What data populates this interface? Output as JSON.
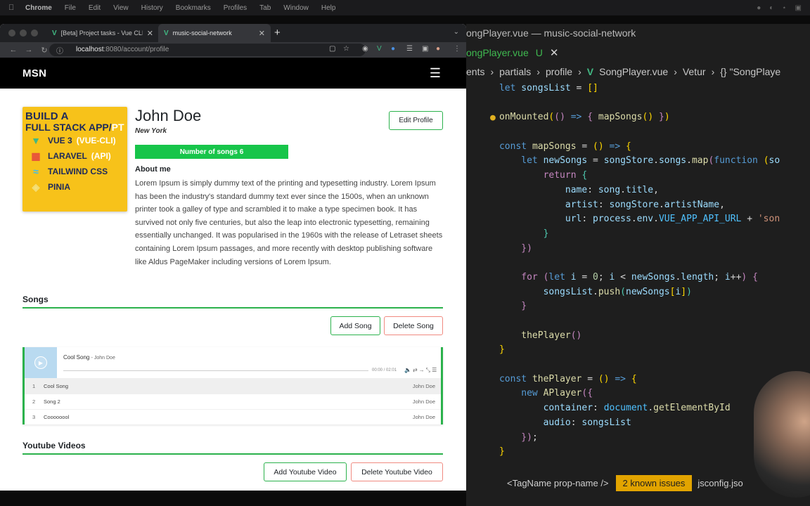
{
  "menubar": {
    "app": "Chrome",
    "items": [
      "File",
      "Edit",
      "View",
      "History",
      "Bookmarks",
      "Profiles",
      "Tab",
      "Window",
      "Help"
    ]
  },
  "browser": {
    "tabs": [
      {
        "label": "[Beta] Project tasks - Vue CLI",
        "icon": "vue-icon"
      },
      {
        "label": "music-social-network",
        "icon": "vue-icon"
      }
    ],
    "url_host": "localhost",
    "url_path": ":8080/account/profile"
  },
  "app": {
    "brand": "MSN",
    "menu_icon": "hamburger-icon"
  },
  "cover": {
    "line1": "BUILD A",
    "line2a": "FULL STACK APP/",
    "line2b": "PT",
    "items": [
      {
        "logo": "vue-logo-icon",
        "text": "VUE 3",
        "extra": "(VUE-CLI)"
      },
      {
        "logo": "laravel-logo-icon",
        "text": "LARAVEL",
        "extra": "(API)"
      },
      {
        "logo": "tailwind-logo-icon",
        "text": "TAILWIND CSS",
        "extra": ""
      },
      {
        "logo": "pinia-logo-icon",
        "text": "PINIA",
        "extra": ""
      }
    ]
  },
  "profile": {
    "name": "John Doe",
    "location": "New York",
    "edit_label": "Edit Profile",
    "songs_badge": "Number of songs 6",
    "about_heading": "About me",
    "about_text": "Lorem Ipsum is simply dummy text of the printing and typesetting industry. Lorem Ipsum has been the industry's standard dummy text ever since the 1500s, when an unknown printer took a galley of type and scrambled it to make a type specimen book. It has survived not only five centuries, but also the leap into electronic typesetting, remaining essentially unchanged. It was popularised in the 1960s with the release of Letraset sheets containing Lorem Ipsum passages, and more recently with desktop publishing software like Aldus PageMaker including versions of Lorem Ipsum."
  },
  "songs": {
    "heading": "Songs",
    "add_label": "Add Song",
    "delete_label": "Delete Song",
    "player": {
      "current_title": "Cool Song",
      "current_artist": "- John Doe",
      "time": "00:00 / 02:01",
      "controls": "🔈⇄→⤡☰",
      "list": [
        {
          "index": "1",
          "title": "Cool Song",
          "artist": "John Doe"
        },
        {
          "index": "2",
          "title": "Song 2",
          "artist": "John Doe"
        },
        {
          "index": "3",
          "title": "Coooooool",
          "artist": "John Doe"
        }
      ]
    }
  },
  "videos": {
    "heading": "Youtube Videos",
    "add_label": "Add Youtube Video",
    "delete_label": "Delete Youtube Video"
  },
  "editor": {
    "title": "ongPlayer.vue — music-social-network",
    "tab": "ongPlayer.vue",
    "tab_flag": "U",
    "breadcrumb": [
      "ents",
      "partials",
      "profile",
      "SongPlayer.vue",
      "Vetur",
      "{} \"SongPlaye"
    ],
    "status_tag": "<TagName prop-name />",
    "status_issues": "2 known issues",
    "status_json": "jsconfig.jso"
  },
  "colors": {
    "accent_green": "#2bb24c",
    "badge_green": "#17c54a",
    "danger_border": "#f08a80",
    "cover_yellow": "#f7c21a"
  }
}
